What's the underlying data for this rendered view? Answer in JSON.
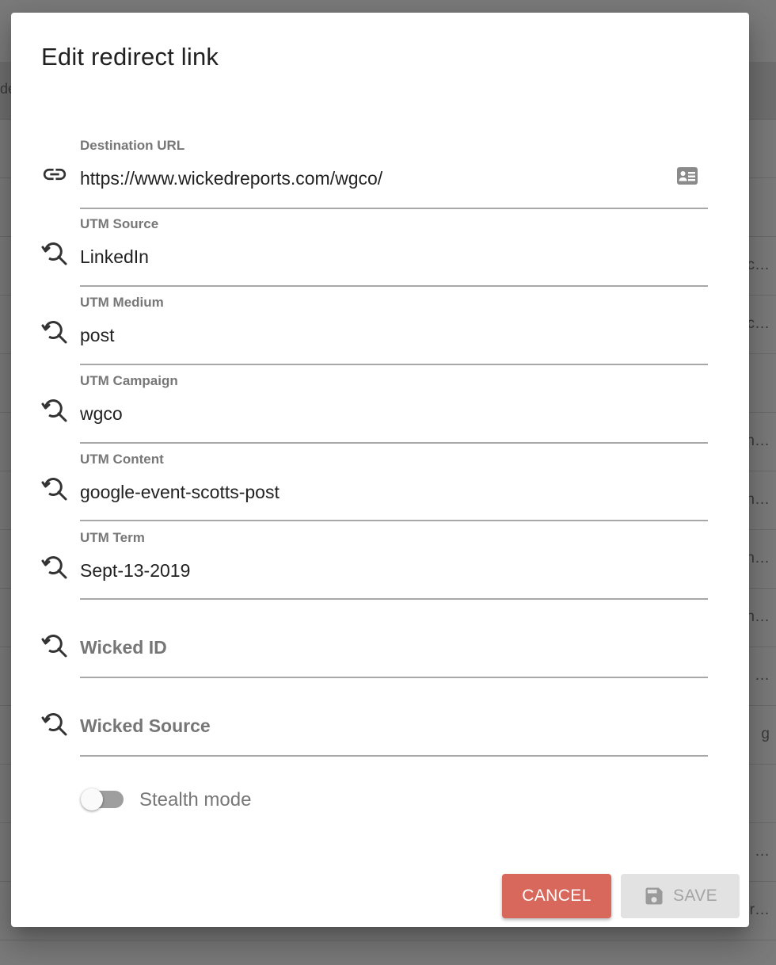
{
  "background": {
    "header_fragment": "de",
    "row_fragments": [
      "c…",
      "c…",
      "",
      "n…",
      "n…",
      "n…",
      "n…",
      "…",
      "g",
      "",
      "…",
      "r…"
    ]
  },
  "dialog": {
    "title": "Edit redirect link",
    "fields": [
      {
        "label": "Destination URL",
        "value": "https://www.wickedreports.com/wgco/",
        "icon": "link-icon"
      },
      {
        "label": "UTM Source",
        "value": "LinkedIn",
        "icon": "search-history-icon"
      },
      {
        "label": "UTM Medium",
        "value": "post",
        "icon": "search-history-icon"
      },
      {
        "label": "UTM Campaign",
        "value": "wgco",
        "icon": "search-history-icon"
      },
      {
        "label": "UTM Content",
        "value": "google-event-scotts-post",
        "icon": "search-history-icon"
      },
      {
        "label": "UTM Term",
        "value": "Sept-13-2019",
        "icon": "search-history-icon"
      },
      {
        "placeholder": "Wicked ID",
        "icon": "search-history-icon"
      },
      {
        "placeholder": "Wicked Source",
        "icon": "search-history-icon"
      }
    ],
    "stealth": {
      "label": "Stealth mode",
      "enabled": false
    },
    "buttons": {
      "cancel": "CANCEL",
      "save": "SAVE"
    },
    "colors": {
      "cancel": "#d9685c",
      "save_disabled": "#e2e2e2"
    }
  }
}
